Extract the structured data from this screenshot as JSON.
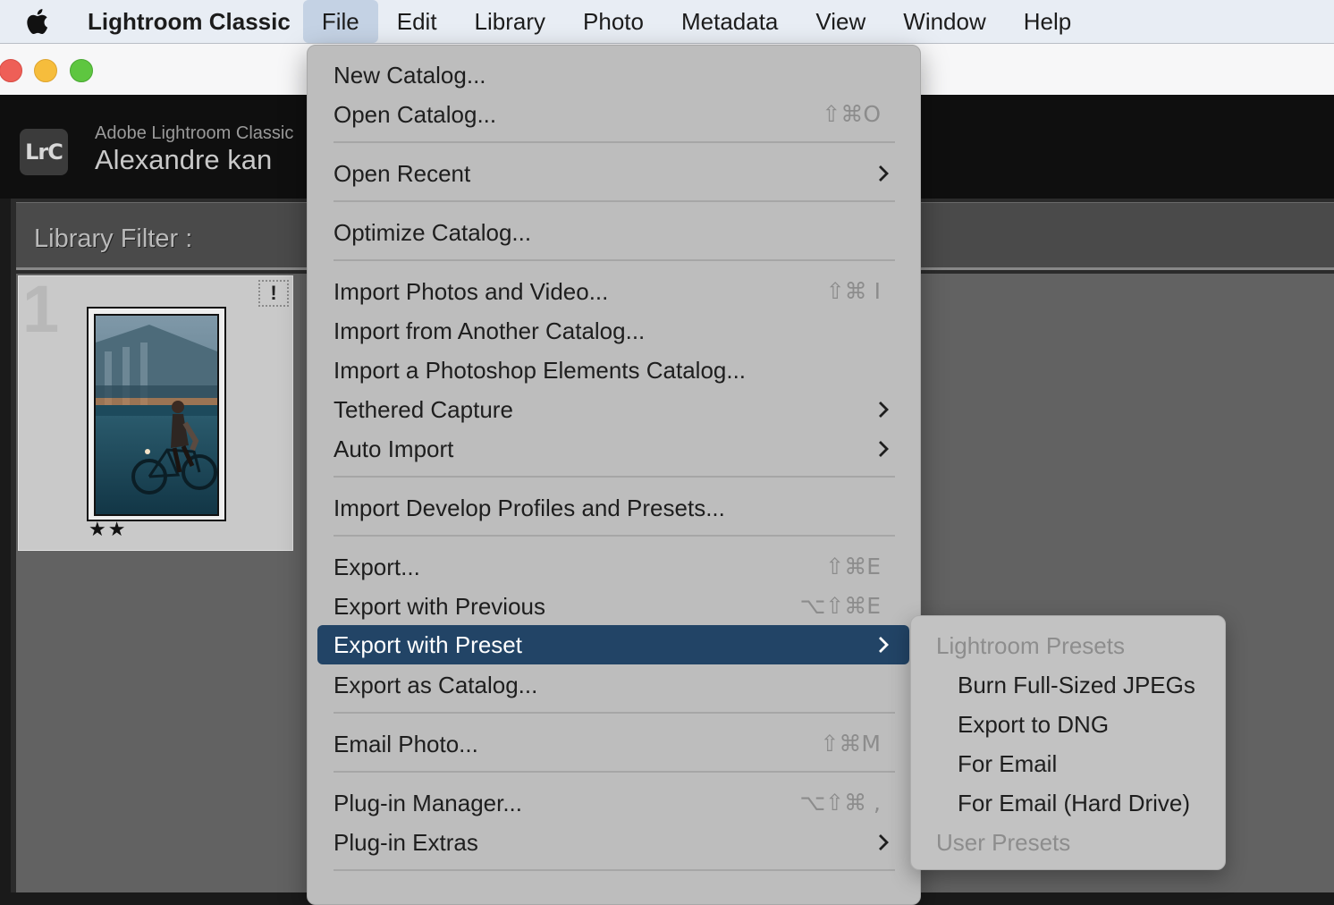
{
  "menubar": {
    "app_name": "Lightroom Classic",
    "menus": [
      "File",
      "Edit",
      "Library",
      "Photo",
      "Metadata",
      "View",
      "Window",
      "Help"
    ],
    "active_menu": "File"
  },
  "lightroom": {
    "product": "Adobe Lightroom Classic",
    "user": "Alexandre kan",
    "logo": "LrC",
    "filter_label": "Library Filter :",
    "grid": {
      "cell_index": "1",
      "badge": "!",
      "rating": "★★"
    }
  },
  "file_menu": {
    "items": [
      {
        "label": "New Catalog...",
        "shortcut": ""
      },
      {
        "label": "Open Catalog...",
        "shortcut": "⇧⌘O"
      },
      {
        "label": "Open Recent",
        "shortcut": "",
        "submenu": true
      },
      {
        "label": "Optimize Catalog...",
        "shortcut": ""
      },
      {
        "label": "Import Photos and Video...",
        "shortcut": "⇧⌘ I"
      },
      {
        "label": "Import from Another Catalog...",
        "shortcut": ""
      },
      {
        "label": "Import a Photoshop Elements Catalog...",
        "shortcut": ""
      },
      {
        "label": "Tethered Capture",
        "shortcut": "",
        "submenu": true
      },
      {
        "label": "Auto Import",
        "shortcut": "",
        "submenu": true
      },
      {
        "label": "Import Develop Profiles and Presets...",
        "shortcut": ""
      },
      {
        "label": "Export...",
        "shortcut": "⇧⌘E"
      },
      {
        "label": "Export with Previous",
        "shortcut": "⌥⇧⌘E"
      },
      {
        "label": "Export with Preset",
        "shortcut": "",
        "submenu": true,
        "highlighted": true
      },
      {
        "label": "Export as Catalog...",
        "shortcut": ""
      },
      {
        "label": "Email Photo...",
        "shortcut": "⇧⌘M"
      },
      {
        "label": "Plug-in Manager...",
        "shortcut": "⌥⇧⌘ ,"
      },
      {
        "label": "Plug-in Extras",
        "shortcut": "",
        "submenu": true
      }
    ]
  },
  "export_preset_submenu": {
    "lightroom_header": "Lightroom Presets",
    "presets": [
      "Burn Full-Sized JPEGs",
      "Export to DNG",
      "For Email",
      "For Email (Hard Drive)"
    ],
    "user_header": "User Presets"
  },
  "colors": {
    "highlight": "#224466",
    "menubar_bg": "#e8edf4",
    "menu_bg": "#bdbdbd"
  }
}
